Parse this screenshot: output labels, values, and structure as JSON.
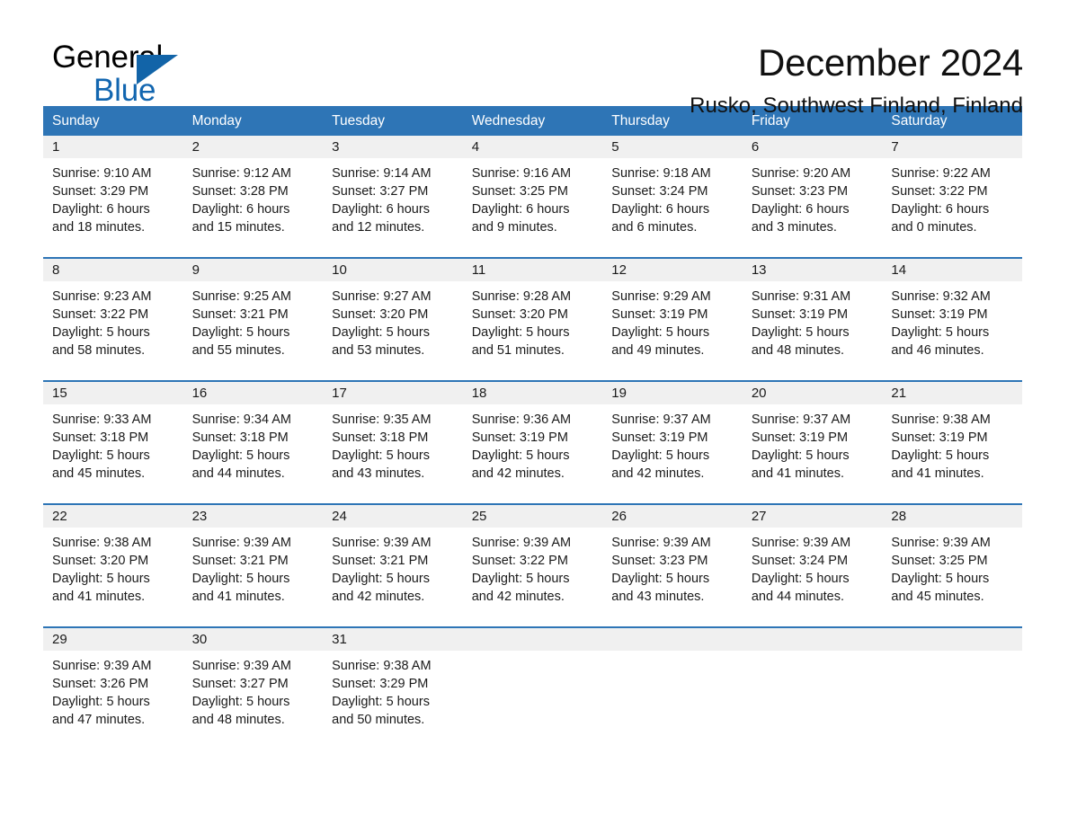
{
  "brand": {
    "name_part1": "General",
    "name_part2": "Blue",
    "accent_color": "#1264a8",
    "triangle_icon": "triangle-icon"
  },
  "header": {
    "month_title": "December 2024",
    "location": "Rusko, Southwest Finland, Finland"
  },
  "calendar": {
    "header_bg": "#2e75b6",
    "daynum_bg": "#f0f0f0",
    "weekdays": [
      "Sunday",
      "Monday",
      "Tuesday",
      "Wednesday",
      "Thursday",
      "Friday",
      "Saturday"
    ],
    "weeks": [
      [
        {
          "day": "1",
          "sunrise": "Sunrise: 9:10 AM",
          "sunset": "Sunset: 3:29 PM",
          "daylight_1": "Daylight: 6 hours",
          "daylight_2": "and 18 minutes."
        },
        {
          "day": "2",
          "sunrise": "Sunrise: 9:12 AM",
          "sunset": "Sunset: 3:28 PM",
          "daylight_1": "Daylight: 6 hours",
          "daylight_2": "and 15 minutes."
        },
        {
          "day": "3",
          "sunrise": "Sunrise: 9:14 AM",
          "sunset": "Sunset: 3:27 PM",
          "daylight_1": "Daylight: 6 hours",
          "daylight_2": "and 12 minutes."
        },
        {
          "day": "4",
          "sunrise": "Sunrise: 9:16 AM",
          "sunset": "Sunset: 3:25 PM",
          "daylight_1": "Daylight: 6 hours",
          "daylight_2": "and 9 minutes."
        },
        {
          "day": "5",
          "sunrise": "Sunrise: 9:18 AM",
          "sunset": "Sunset: 3:24 PM",
          "daylight_1": "Daylight: 6 hours",
          "daylight_2": "and 6 minutes."
        },
        {
          "day": "6",
          "sunrise": "Sunrise: 9:20 AM",
          "sunset": "Sunset: 3:23 PM",
          "daylight_1": "Daylight: 6 hours",
          "daylight_2": "and 3 minutes."
        },
        {
          "day": "7",
          "sunrise": "Sunrise: 9:22 AM",
          "sunset": "Sunset: 3:22 PM",
          "daylight_1": "Daylight: 6 hours",
          "daylight_2": "and 0 minutes."
        }
      ],
      [
        {
          "day": "8",
          "sunrise": "Sunrise: 9:23 AM",
          "sunset": "Sunset: 3:22 PM",
          "daylight_1": "Daylight: 5 hours",
          "daylight_2": "and 58 minutes."
        },
        {
          "day": "9",
          "sunrise": "Sunrise: 9:25 AM",
          "sunset": "Sunset: 3:21 PM",
          "daylight_1": "Daylight: 5 hours",
          "daylight_2": "and 55 minutes."
        },
        {
          "day": "10",
          "sunrise": "Sunrise: 9:27 AM",
          "sunset": "Sunset: 3:20 PM",
          "daylight_1": "Daylight: 5 hours",
          "daylight_2": "and 53 minutes."
        },
        {
          "day": "11",
          "sunrise": "Sunrise: 9:28 AM",
          "sunset": "Sunset: 3:20 PM",
          "daylight_1": "Daylight: 5 hours",
          "daylight_2": "and 51 minutes."
        },
        {
          "day": "12",
          "sunrise": "Sunrise: 9:29 AM",
          "sunset": "Sunset: 3:19 PM",
          "daylight_1": "Daylight: 5 hours",
          "daylight_2": "and 49 minutes."
        },
        {
          "day": "13",
          "sunrise": "Sunrise: 9:31 AM",
          "sunset": "Sunset: 3:19 PM",
          "daylight_1": "Daylight: 5 hours",
          "daylight_2": "and 48 minutes."
        },
        {
          "day": "14",
          "sunrise": "Sunrise: 9:32 AM",
          "sunset": "Sunset: 3:19 PM",
          "daylight_1": "Daylight: 5 hours",
          "daylight_2": "and 46 minutes."
        }
      ],
      [
        {
          "day": "15",
          "sunrise": "Sunrise: 9:33 AM",
          "sunset": "Sunset: 3:18 PM",
          "daylight_1": "Daylight: 5 hours",
          "daylight_2": "and 45 minutes."
        },
        {
          "day": "16",
          "sunrise": "Sunrise: 9:34 AM",
          "sunset": "Sunset: 3:18 PM",
          "daylight_1": "Daylight: 5 hours",
          "daylight_2": "and 44 minutes."
        },
        {
          "day": "17",
          "sunrise": "Sunrise: 9:35 AM",
          "sunset": "Sunset: 3:18 PM",
          "daylight_1": "Daylight: 5 hours",
          "daylight_2": "and 43 minutes."
        },
        {
          "day": "18",
          "sunrise": "Sunrise: 9:36 AM",
          "sunset": "Sunset: 3:19 PM",
          "daylight_1": "Daylight: 5 hours",
          "daylight_2": "and 42 minutes."
        },
        {
          "day": "19",
          "sunrise": "Sunrise: 9:37 AM",
          "sunset": "Sunset: 3:19 PM",
          "daylight_1": "Daylight: 5 hours",
          "daylight_2": "and 42 minutes."
        },
        {
          "day": "20",
          "sunrise": "Sunrise: 9:37 AM",
          "sunset": "Sunset: 3:19 PM",
          "daylight_1": "Daylight: 5 hours",
          "daylight_2": "and 41 minutes."
        },
        {
          "day": "21",
          "sunrise": "Sunrise: 9:38 AM",
          "sunset": "Sunset: 3:19 PM",
          "daylight_1": "Daylight: 5 hours",
          "daylight_2": "and 41 minutes."
        }
      ],
      [
        {
          "day": "22",
          "sunrise": "Sunrise: 9:38 AM",
          "sunset": "Sunset: 3:20 PM",
          "daylight_1": "Daylight: 5 hours",
          "daylight_2": "and 41 minutes."
        },
        {
          "day": "23",
          "sunrise": "Sunrise: 9:39 AM",
          "sunset": "Sunset: 3:21 PM",
          "daylight_1": "Daylight: 5 hours",
          "daylight_2": "and 41 minutes."
        },
        {
          "day": "24",
          "sunrise": "Sunrise: 9:39 AM",
          "sunset": "Sunset: 3:21 PM",
          "daylight_1": "Daylight: 5 hours",
          "daylight_2": "and 42 minutes."
        },
        {
          "day": "25",
          "sunrise": "Sunrise: 9:39 AM",
          "sunset": "Sunset: 3:22 PM",
          "daylight_1": "Daylight: 5 hours",
          "daylight_2": "and 42 minutes."
        },
        {
          "day": "26",
          "sunrise": "Sunrise: 9:39 AM",
          "sunset": "Sunset: 3:23 PM",
          "daylight_1": "Daylight: 5 hours",
          "daylight_2": "and 43 minutes."
        },
        {
          "day": "27",
          "sunrise": "Sunrise: 9:39 AM",
          "sunset": "Sunset: 3:24 PM",
          "daylight_1": "Daylight: 5 hours",
          "daylight_2": "and 44 minutes."
        },
        {
          "day": "28",
          "sunrise": "Sunrise: 9:39 AM",
          "sunset": "Sunset: 3:25 PM",
          "daylight_1": "Daylight: 5 hours",
          "daylight_2": "and 45 minutes."
        }
      ],
      [
        {
          "day": "29",
          "sunrise": "Sunrise: 9:39 AM",
          "sunset": "Sunset: 3:26 PM",
          "daylight_1": "Daylight: 5 hours",
          "daylight_2": "and 47 minutes."
        },
        {
          "day": "30",
          "sunrise": "Sunrise: 9:39 AM",
          "sunset": "Sunset: 3:27 PM",
          "daylight_1": "Daylight: 5 hours",
          "daylight_2": "and 48 minutes."
        },
        {
          "day": "31",
          "sunrise": "Sunrise: 9:38 AM",
          "sunset": "Sunset: 3:29 PM",
          "daylight_1": "Daylight: 5 hours",
          "daylight_2": "and 50 minutes."
        },
        {
          "day": "",
          "sunrise": "",
          "sunset": "",
          "daylight_1": "",
          "daylight_2": ""
        },
        {
          "day": "",
          "sunrise": "",
          "sunset": "",
          "daylight_1": "",
          "daylight_2": ""
        },
        {
          "day": "",
          "sunrise": "",
          "sunset": "",
          "daylight_1": "",
          "daylight_2": ""
        },
        {
          "day": "",
          "sunrise": "",
          "sunset": "",
          "daylight_1": "",
          "daylight_2": ""
        }
      ]
    ]
  }
}
